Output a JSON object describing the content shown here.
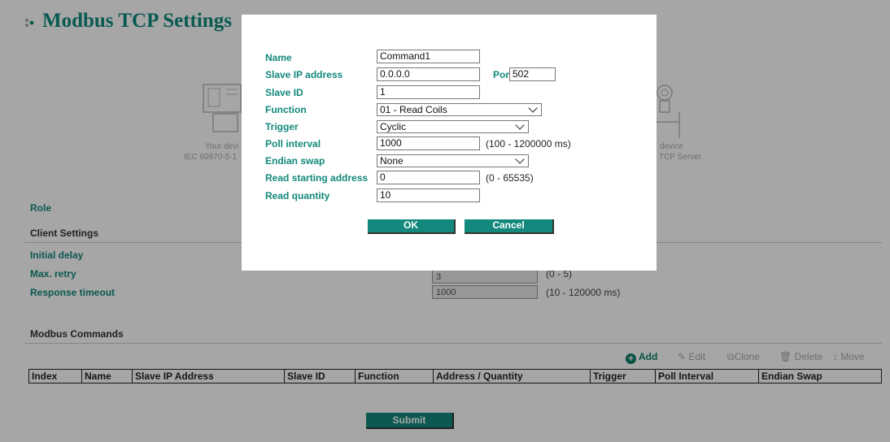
{
  "page": {
    "title": "Modbus TCP Settings",
    "diagram": {
      "left_line1": "Your devi",
      "left_line2": "IEC 60870-5-1",
      "right_line1": "device",
      "right_line2": "TCP Server"
    },
    "role_label": "Role",
    "client_settings": {
      "title": "Client Settings",
      "initial_delay_label": "Initial delay",
      "max_retry_label": "Max. retry",
      "max_retry_value": "3",
      "max_retry_range": "(0 - 5)",
      "response_timeout_label": "Response timeout",
      "response_timeout_value": "1000",
      "response_timeout_range": "(10 - 120000 ms)"
    },
    "modbus_commands": {
      "title": "Modbus Commands",
      "toolbar": {
        "add": "Add",
        "edit": "Edit",
        "clone": "Clone",
        "delete": "Delete",
        "move": "Move"
      },
      "columns": [
        "Index",
        "Name",
        "Slave IP Address",
        "Slave ID",
        "Function",
        "Address / Quantity",
        "Trigger",
        "Poll Interval",
        "Endian Swap"
      ]
    },
    "submit_label": "Submit"
  },
  "dialog": {
    "name_label": "Name",
    "name_value": "Command1",
    "slave_ip_label": "Slave IP address",
    "slave_ip_value": "0.0.0.0",
    "port_label": "Port",
    "port_value": "502",
    "slave_id_label": "Slave ID",
    "slave_id_value": "1",
    "function_label": "Function",
    "function_value": "01 - Read Coils",
    "trigger_label": "Trigger",
    "trigger_value": "Cyclic",
    "poll_interval_label": "Poll interval",
    "poll_interval_value": "1000",
    "poll_interval_range": "(100 - 1200000 ms)",
    "endian_swap_label": "Endian swap",
    "endian_swap_value": "None",
    "read_start_label": "Read starting address",
    "read_start_value": "0",
    "read_start_range": "(0 - 65535)",
    "read_quantity_label": "Read quantity",
    "read_quantity_value": "10",
    "ok_label": "OK",
    "cancel_label": "Cancel"
  },
  "colors": {
    "accent": "#12897c",
    "overlay": "#000000"
  }
}
